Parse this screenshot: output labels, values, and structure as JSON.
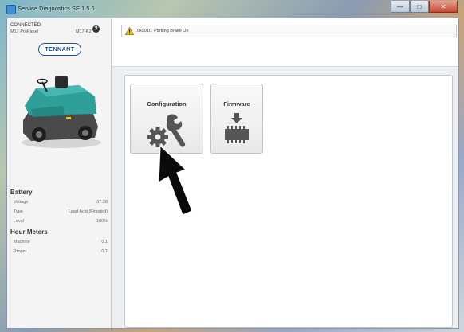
{
  "window": {
    "title": "Service Diagnostics SE 1.5.6",
    "controls": [
      "—",
      "□",
      "✕"
    ]
  },
  "sidebar": {
    "connection_status": "CONNECTED:",
    "panel_name": "M17 ProPanel",
    "model_code": "M17-R2",
    "help_icon": "?",
    "logo_text": "TENNANT",
    "battery": {
      "title": "Battery",
      "rows": [
        {
          "label": "Voltage",
          "value": "37.28"
        },
        {
          "label": "Type",
          "value": "Lead Acid (Flooded)"
        },
        {
          "label": "Level",
          "value": "100%"
        }
      ]
    },
    "hour_meters": {
      "title": "Hour Meters",
      "rows": [
        {
          "label": "Machine",
          "value": "0.1"
        },
        {
          "label": "Propel",
          "value": "0.1"
        }
      ]
    }
  },
  "header": {
    "alert_icon": "warning-icon",
    "alert_text": "0x0010: Parking Brake On"
  },
  "tiles": [
    {
      "label": "Configuration",
      "icon": "tools-icon"
    },
    {
      "label": "Firmware",
      "icon": "firmware-chip-icon"
    }
  ],
  "colors": {
    "accent": "#2f9f9a",
    "brand": "#1a4f9c",
    "warning": "#f2c200"
  }
}
